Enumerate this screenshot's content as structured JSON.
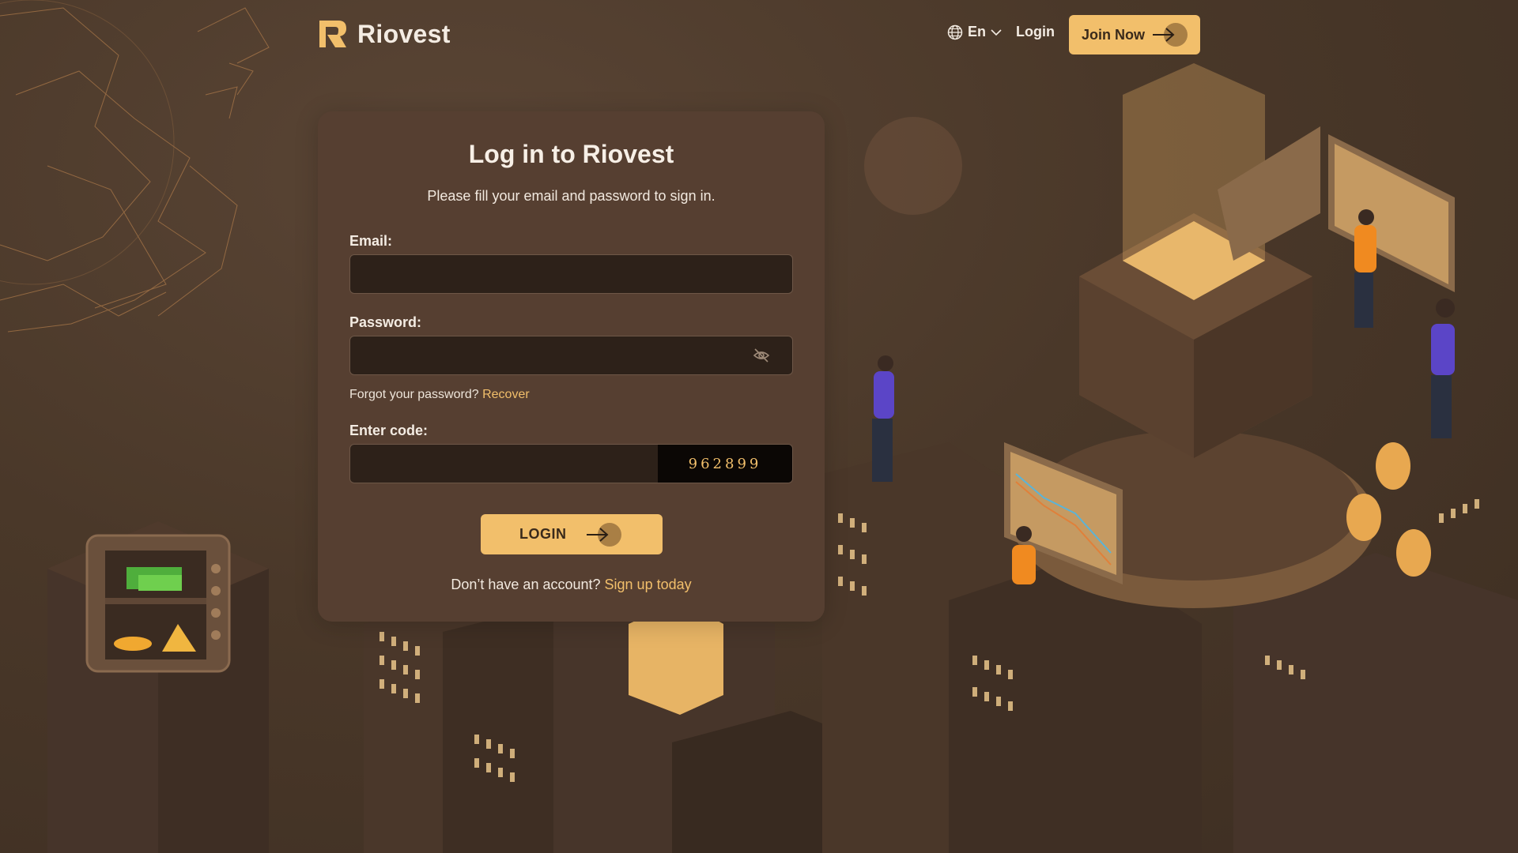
{
  "brand": {
    "name": "Riovest",
    "accent": "#f2bf6b"
  },
  "header": {
    "language": "En",
    "login_label": "Login",
    "join_label": "Join Now"
  },
  "form": {
    "title": "Log in to Riovest",
    "subtitle": "Please fill your email and password to sign in.",
    "email_label": "Email:",
    "email_value": "",
    "password_label": "Password:",
    "password_value": "",
    "forgot_text": "Forgot your password?",
    "recover_label": "Recover",
    "code_label": "Enter code:",
    "code_value": "",
    "captcha": "962899",
    "submit_label": "LOGIN",
    "signup_text": "Don’t have an account?",
    "signup_link": "Sign up today"
  },
  "icons": {
    "language": "globe-icon",
    "language_dropdown": "chevron-down-icon",
    "password_toggle": "eye-off-icon",
    "arrow": "arrow-right-icon"
  }
}
